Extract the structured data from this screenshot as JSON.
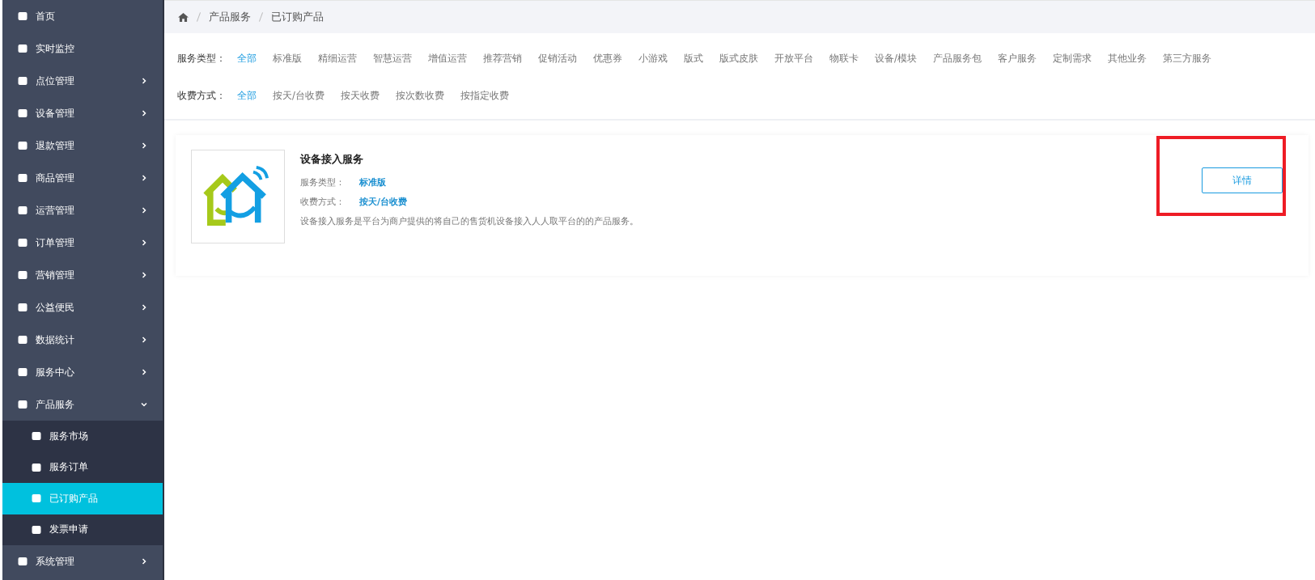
{
  "sidebar": {
    "items": [
      {
        "label": "首页",
        "kind": "link"
      },
      {
        "label": "实时监控",
        "kind": "link"
      },
      {
        "label": "点位管理",
        "kind": "group",
        "expanded": false
      },
      {
        "label": "设备管理",
        "kind": "group",
        "expanded": false
      },
      {
        "label": "退款管理",
        "kind": "group",
        "expanded": false
      },
      {
        "label": "商品管理",
        "kind": "group",
        "expanded": false
      },
      {
        "label": "运营管理",
        "kind": "group",
        "expanded": false
      },
      {
        "label": "订单管理",
        "kind": "group",
        "expanded": false
      },
      {
        "label": "营销管理",
        "kind": "group",
        "expanded": false
      },
      {
        "label": "公益便民",
        "kind": "group",
        "expanded": false
      },
      {
        "label": "数据统计",
        "kind": "group",
        "expanded": false
      },
      {
        "label": "服务中心",
        "kind": "group",
        "expanded": false
      },
      {
        "label": "产品服务",
        "kind": "group",
        "expanded": true,
        "children": [
          {
            "label": "服务市场",
            "selected": false
          },
          {
            "label": "服务订单",
            "selected": false
          },
          {
            "label": "已订购产品",
            "selected": true
          },
          {
            "label": "发票申请",
            "selected": false
          }
        ]
      },
      {
        "label": "系统管理",
        "kind": "group",
        "expanded": false
      }
    ]
  },
  "breadcrumb": [
    "产品服务",
    "已订购产品"
  ],
  "filters": [
    {
      "label": "服务类型：",
      "options": [
        {
          "label": "全部",
          "selected": true
        },
        {
          "label": "标准版",
          "selected": false
        },
        {
          "label": "精细运营",
          "selected": false
        },
        {
          "label": "智慧运营",
          "selected": false
        },
        {
          "label": "增值运营",
          "selected": false
        },
        {
          "label": "推荐营销",
          "selected": false
        },
        {
          "label": "促销活动",
          "selected": false
        },
        {
          "label": "优惠券",
          "selected": false
        },
        {
          "label": "小游戏",
          "selected": false
        },
        {
          "label": "版式",
          "selected": false
        },
        {
          "label": "版式皮肤",
          "selected": false
        },
        {
          "label": "开放平台",
          "selected": false
        },
        {
          "label": "物联卡",
          "selected": false
        },
        {
          "label": "设备/模块",
          "selected": false
        },
        {
          "label": "产品服务包",
          "selected": false
        },
        {
          "label": "客户服务",
          "selected": false
        },
        {
          "label": "定制需求",
          "selected": false
        },
        {
          "label": "其他业务",
          "selected": false
        },
        {
          "label": "第三方服务",
          "selected": false
        }
      ]
    },
    {
      "label": "收费方式：",
      "options": [
        {
          "label": "全部",
          "selected": true
        },
        {
          "label": "按天/台收费",
          "selected": false
        },
        {
          "label": "按天收费",
          "selected": false
        },
        {
          "label": "按次数收费",
          "selected": false
        },
        {
          "label": "按指定收费",
          "selected": false
        }
      ]
    }
  ],
  "products": [
    {
      "title": "设备接入服务",
      "fields": [
        {
          "label": "服务类型：",
          "value": "标准版"
        },
        {
          "label": "收费方式：",
          "value": "按天/台收费"
        }
      ],
      "description": "设备接入服务是平台为商户提供的将自己的售货机设备接入人人取平台的的产品服务。",
      "button": "详情",
      "highlighted": true
    }
  ]
}
